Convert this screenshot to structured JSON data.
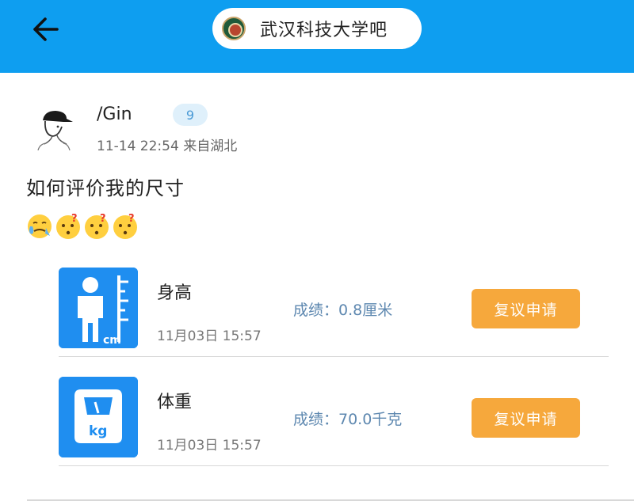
{
  "header": {
    "back_icon": "arrow-left-icon",
    "forum_name": "武汉科技大学吧",
    "forum_logo_icon": "university-logo-icon",
    "bg_color": "#0e9ef0"
  },
  "post": {
    "username": "/Gin",
    "level": "9",
    "datetime": "11-14 22:54",
    "location": "来自湖北",
    "meta": "11-14 22:54 来自湖北",
    "title": "如何评价我的尺寸",
    "emojis": [
      "crying-sweat-emoji",
      "confused-emoji",
      "confused-emoji",
      "confused-emoji"
    ]
  },
  "records": [
    {
      "icon": "height-ruler-icon",
      "name": "身高",
      "time": "11月03日 15:57",
      "score": "成绩：0.8厘米",
      "button": "复议申请"
    },
    {
      "icon": "weight-scale-icon",
      "name": "体重",
      "time": "11月03日 15:57",
      "score": "成绩：70.0千克",
      "button": "复议申请"
    }
  ],
  "icon_labels": {
    "height_unit": "cm",
    "weight_unit": "kg"
  },
  "colors": {
    "accent_blue": "#1f8ef0",
    "button_orange": "#f6a83c",
    "score_text": "#5e88b0"
  }
}
